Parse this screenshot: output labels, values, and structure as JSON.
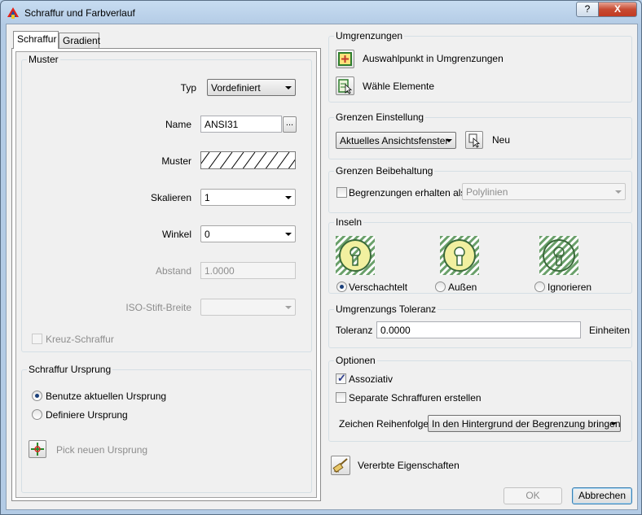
{
  "window": {
    "title": "Schraffur und Farbverlauf",
    "help": "?",
    "close": "X"
  },
  "tabs": [
    {
      "label": "Schraffur"
    },
    {
      "label": "Gradient"
    }
  ],
  "muster": {
    "title": "Muster",
    "typ_label": "Typ",
    "typ_value": "Vordefiniert",
    "name_label": "Name",
    "name_value": "ANSI31",
    "browse": "...",
    "muster_label": "Muster",
    "skalieren_label": "Skalieren",
    "skalieren_value": "1",
    "winkel_label": "Winkel",
    "winkel_value": "0",
    "abstand_label": "Abstand",
    "abstand_value": "1.0000",
    "iso_label": "ISO-Stift-Breite",
    "iso_value": "",
    "kreuz_label": "Kreuz-Schraffur"
  },
  "ursprung": {
    "title": "Schraffur Ursprung",
    "benutze": "Benutze aktuellen Ursprung",
    "definiere": "Definiere Ursprung",
    "pick": "Pick neuen Ursprung"
  },
  "umgrenzungen": {
    "title": "Umgrenzungen",
    "auswahl": "Auswahlpunkt in Umgrenzungen",
    "waehle": "Wähle Elemente"
  },
  "grenzen": {
    "title": "Grenzen Einstellung",
    "value": "Aktuelles Ansichtsfenster",
    "neu": "Neu"
  },
  "beibehaltung": {
    "title": "Grenzen Beibehaltung",
    "check_label": "Begrenzungen erhalten als",
    "value": "Polylinien"
  },
  "inseln": {
    "title": "Inseln",
    "options": [
      {
        "label": "Verschachtelt",
        "selected": true
      },
      {
        "label": "Außen",
        "selected": false
      },
      {
        "label": "Ignorieren",
        "selected": false
      }
    ]
  },
  "toleranz": {
    "title": "Umgrenzungs Toleranz",
    "label": "Toleranz",
    "value": "0.0000",
    "unit": "Einheiten"
  },
  "optionen": {
    "title": "Optionen",
    "assoziativ": "Assoziativ",
    "separate": "Separate Schraffuren erstellen",
    "reihenfolge_label": "Zeichen Reihenfolge",
    "reihenfolge_value": "In den Hintergrund der Begrenzung bringen"
  },
  "vererbte": "Vererbte Eigenschaften",
  "buttons": {
    "ok": "OK",
    "cancel": "Abbrechen"
  }
}
